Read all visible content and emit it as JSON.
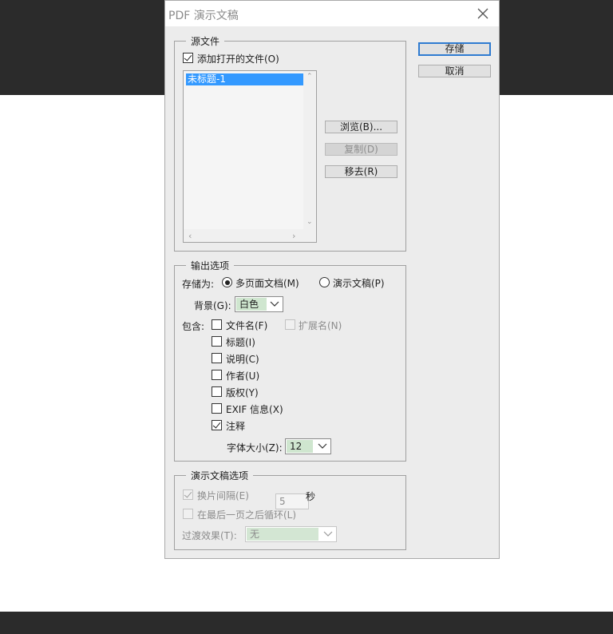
{
  "dialog": {
    "title": "PDF 演示文稿",
    "save_label": "存储",
    "cancel_label": "取消"
  },
  "source_files": {
    "legend": "源文件",
    "add_open_files_label": "添加打开的文件(O)",
    "add_open_files_checked": true,
    "files": [
      "未标题-1"
    ],
    "browse_label": "浏览(B)...",
    "duplicate_label": "复制(D)",
    "remove_label": "移去(R)"
  },
  "output_options": {
    "legend": "输出选项",
    "save_as_label": "存储为:",
    "multipage_label": "多页面文档(M)",
    "presentation_label": "演示文稿(P)",
    "selected_mode": "multipage",
    "background_label": "背景(G):",
    "background_value": "白色",
    "include_label": "包含:",
    "filename_label": "文件名(F)",
    "extension_label": "扩展名(N)",
    "title_label": "标题(I)",
    "description_label": "说明(C)",
    "author_label": "作者(U)",
    "copyright_label": "版权(Y)",
    "exif_label": "EXIF 信息(X)",
    "annotations_label": "注释",
    "annotations_checked": true,
    "font_size_label": "字体大小(Z):",
    "font_size_value": "12"
  },
  "presentation_options": {
    "legend": "演示文稿选项",
    "advance_label": "换片间隔(E)",
    "advance_checked": true,
    "advance_value": "5",
    "seconds_label": "秒",
    "loop_label": "在最后一页之后循环(L)",
    "transition_label": "过渡效果(T):",
    "transition_value": "无"
  },
  "colors": {
    "primary_button_border": "#2f7bd1",
    "list_selection": "#3399ff",
    "select_value_bg": "#cfe6cf",
    "dialog_bg": "#ececec",
    "backdrop_dark": "#2b2b2b"
  }
}
